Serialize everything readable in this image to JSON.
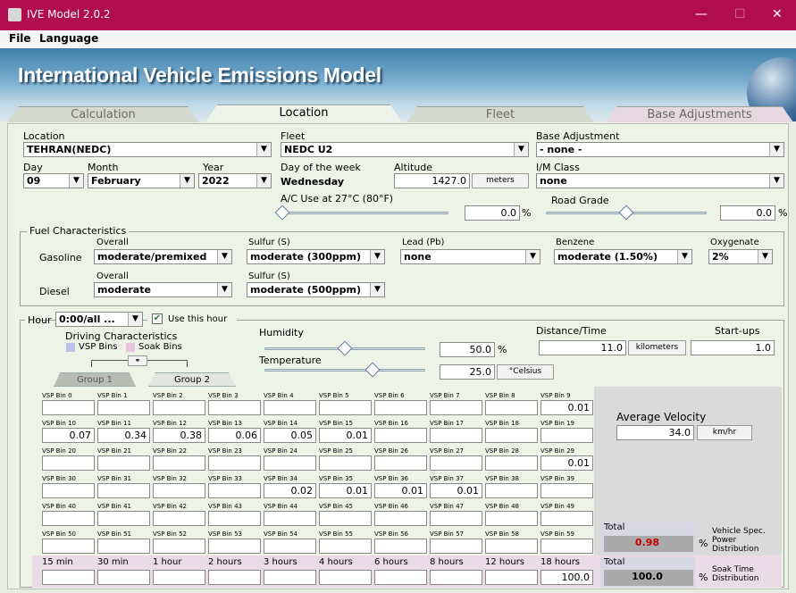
{
  "window": {
    "title": "IVE Model 2.0.2",
    "minimize": "—",
    "maximize": "☐",
    "close": "✕"
  },
  "menu": {
    "file": "File",
    "language": "Language"
  },
  "banner": {
    "title": "International Vehicle Emissions Model"
  },
  "tabs": {
    "calculation": "Calculation",
    "location": "Location",
    "fleet": "Fleet",
    "base_adjustments": "Base Adjustments"
  },
  "location": {
    "location_label": "Location",
    "location_value": "TEHRAN(NEDC)",
    "fleet_label": "Fleet",
    "fleet_value": "NEDC U2",
    "base_adj_label": "Base Adjustment",
    "base_adj_value": "- none -",
    "day_label": "Day",
    "day_value": "09",
    "month_label": "Month",
    "month_value": "February",
    "year_label": "Year",
    "year_value": "2022",
    "dow_label": "Day of the week",
    "dow_value": "Wednesday",
    "altitude_label": "Altitude",
    "altitude_value": "1427.0",
    "altitude_unit": "meters",
    "im_label": "I/M Class",
    "im_value": "none",
    "ac_label": "A/C Use at 27°C (80°F)",
    "ac_value": "0.0",
    "ac_unit": "%",
    "ac_level": 0,
    "grade_label": "Road Grade",
    "grade_value": "0.0",
    "grade_unit": "%",
    "grade_level": 0.5
  },
  "fuel": {
    "title": "Fuel Characteristics",
    "gasoline": "Gasoline",
    "diesel": "Diesel",
    "overall": "Overall",
    "sulfur": "Sulfur (S)",
    "lead": "Lead (Pb)",
    "benzene": "Benzene",
    "oxygenate": "Oxygenate",
    "gas_overall": "moderate/premixed",
    "gas_sulfur": "moderate (300ppm)",
    "gas_lead": "none",
    "gas_benzene": "moderate (1.50%)",
    "gas_oxygenate": "2%",
    "diesel_overall_label": "Overall",
    "diesel_overall": "moderate",
    "diesel_sulfur_label": "Sulfur (S)",
    "diesel_sulfur": "moderate (500ppm)"
  },
  "hour": {
    "label": "Hour",
    "value": "0:00/all ...",
    "use_label": "Use this hour",
    "use_checked": true,
    "driving_label": "Driving Characteristics",
    "vsp_legend": "VSP Bins",
    "soak_legend": "Soak Bins",
    "vsp_color": "#b9c3e6",
    "soak_color": "#e6c3dc",
    "link_btn": "⚭",
    "humidity_label": "Humidity",
    "humidity_value": "50.0",
    "humidity_unit": "%",
    "humidity_level": 0.5,
    "temp_label": "Temperature",
    "temp_value": "25.0",
    "temp_unit": "°Celsius",
    "temp_level": 0.67,
    "dist_label": "Distance/Time",
    "dist_value": "11.0",
    "dist_unit": "kilometers",
    "startups_label": "Start-ups",
    "startups_value": "1.0",
    "group1": "Group 1",
    "group2": "Group 2"
  },
  "vsp": {
    "labels": [
      "VSP Bin 0",
      "VSP Bin 1",
      "VSP Bin 2",
      "VSP Bin 3",
      "VSP Bin 4",
      "VSP Bin 5",
      "VSP Bin 6",
      "VSP Bin 7",
      "VSP Bin 8",
      "VSP Bin 9",
      "VSP Bin 10",
      "VSP Bin 11",
      "VSP Bin 12",
      "VSP Bin 13",
      "VSP Bin 14",
      "VSP Bin 15",
      "VSP Bin 16",
      "VSP Bin 17",
      "VSP Bin 18",
      "VSP Bin 19",
      "VSP Bin 20",
      "VSP Bin 21",
      "VSP Bin 22",
      "VSP Bin 23",
      "VSP Bin 24",
      "VSP Bin 25",
      "VSP Bin 26",
      "VSP Bin 27",
      "VSP Bin 28",
      "VSP Bin 29",
      "VSP Bin 30",
      "VSP Bin 31",
      "VSP Bin 32",
      "VSP Bin 33",
      "VSP Bin 34",
      "VSP Bin 35",
      "VSP Bin 36",
      "VSP Bin 37",
      "VSP Bin 38",
      "VSP Bin 39",
      "VSP Bin 40",
      "VSP Bin 41",
      "VSP Bin 42",
      "VSP Bin 43",
      "VSP Bin 44",
      "VSP Bin 45",
      "VSP Bin 46",
      "VSP Bin 47",
      "VSP Bin 48",
      "VSP Bin 49",
      "VSP Bin 50",
      "VSP Bin 51",
      "VSP Bin 52",
      "VSP Bin 53",
      "VSP Bin 54",
      "VSP Bin 55",
      "VSP Bin 56",
      "VSP Bin 57",
      "VSP Bin 58",
      "VSP Bin 59"
    ],
    "values": [
      "",
      "",
      "",
      "",
      "",
      "",
      "",
      "",
      "",
      "0.01",
      "0.07",
      "0.34",
      "0.38",
      "0.06",
      "0.05",
      "0.01",
      "",
      "",
      "",
      "",
      "",
      "",
      "",
      "",
      "",
      "",
      "",
      "",
      "",
      "0.01",
      "",
      "",
      "",
      "",
      "0.02",
      "0.01",
      "0.01",
      "0.01",
      "",
      "",
      "",
      "",
      "",
      "",
      "",
      "",
      "",
      "",
      "",
      "",
      "",
      "",
      "",
      "",
      "",
      "",
      "",
      "",
      "",
      ""
    ],
    "avg_vel_label": "Average Velocity",
    "avg_vel_value": "34.0",
    "avg_vel_unit": "km/hr",
    "total_label": "Total",
    "total_value": "0.98",
    "total_color": "#c00000",
    "total_pct": "%",
    "vsp_dist_label": "Vehicle Spec. Power Distribution"
  },
  "soak": {
    "labels": [
      "15 min",
      "30 min",
      "1 hour",
      "2 hours",
      "3 hours",
      "4 hours",
      "6 hours",
      "8 hours",
      "12 hours",
      "18 hours"
    ],
    "values": [
      "",
      "",
      "",
      "",
      "",
      "",
      "",
      "",
      "",
      "100.0"
    ],
    "total_label": "Total",
    "total_value": "100.0",
    "total_pct": "%",
    "soak_dist_label": "Soak Time Distribution"
  }
}
